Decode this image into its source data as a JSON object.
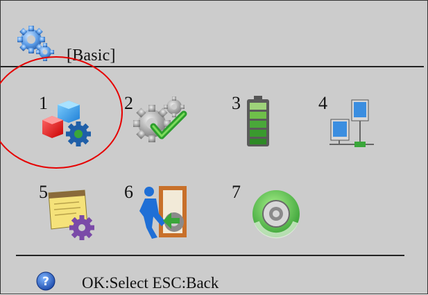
{
  "header": {
    "title": "[Basic]",
    "icon": "gears-icon"
  },
  "menu": {
    "selected_number": "1",
    "items": [
      {
        "number": "1",
        "icon": "blocks-settings-icon"
      },
      {
        "number": "2",
        "icon": "gears-check-icon"
      },
      {
        "number": "3",
        "icon": "battery-icon"
      },
      {
        "number": "4",
        "icon": "network-icon"
      },
      {
        "number": "5",
        "icon": "notepad-gear-icon"
      },
      {
        "number": "6",
        "icon": "exit-door-icon"
      },
      {
        "number": "7",
        "icon": "reset-icon"
      }
    ]
  },
  "footer": {
    "hint": "OK:Select ESC:Back",
    "icon": "help-icon"
  },
  "colors": {
    "screen_bg": "#cccccc",
    "selection": "#e60000",
    "accent_green": "#3aa63a",
    "accent_blue": "#2a7fd6"
  }
}
